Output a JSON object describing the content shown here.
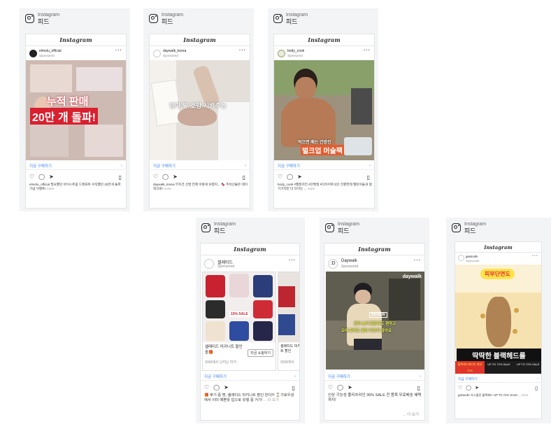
{
  "header": {
    "app_label": "Instagram",
    "feed_label": "피드"
  },
  "wordmark": "Instagram",
  "cta_label": "지금 구매하기",
  "more_label": "more",
  "more_label_kr": "... 더 보기",
  "ads": [
    {
      "account": "elmolu_official",
      "sponsored": "Sponsored",
      "overlay_line1": "누적 판매",
      "overlay_line2": "20만 개 돌파!",
      "caption": "elmolu_official 필요했던 아이스트림 드래프트 수직했던 20만개 돌파 기념 이벤트!",
      "bg": "#c9b7b0"
    },
    {
      "account": "daywalk_korea",
      "sponsored": "Sponsored",
      "overlay_line1": "엄마 발 호강 시켜주는",
      "caption": "daywalk_korea 무조건 신발 언제 이렇게 보였지... 🍫 추석선물은 데이워크로!",
      "bg": "#e2ddd6"
    },
    {
      "account": "body_cook",
      "sponsored": "Sponsored",
      "overlay_line1": "먹으면 배는 건방진",
      "overlay_line2": "벌크업 머슬팩",
      "caption": "body_cook #헬창치킨 #단백질 #다이어트식단 간편한데 헬린이들과 챙기기지만 더 다이는 ...",
      "bg": "#7f8a63"
    },
    {
      "account": "셀레티드",
      "sponsored": "Sponsored",
      "product_title": "셀레티드 미키니트 할인중🎁",
      "product_sub": "SNS에서 난리난 미키",
      "shop_button": "지금 쇼핑하기",
      "second_title": "셀레티드 미키니트 할인",
      "second_sub": "SNS에서",
      "sale_text": "15% SALE",
      "caption": "🎁 후기 증 명, 셀레티드 미키니트 할인 한다!!! ⌛️기로우셨에서 이미 예쁜옷 입으로 유행 중 거기!"
    },
    {
      "account": "Daywalk",
      "sponsored": "Sponsored",
      "brand_tag": "daywalk",
      "review_tag": "REVIEW",
      "overlay_line1": "굽이 높지 않은데도 편하고",
      "overlay_line2": "오래 걸어도 발이 아프지 않아요",
      "caption": "신상 기능성 플리츠라인 36% SALE 전 품목 무료배송 혜택까지!"
    },
    {
      "account": "gasmulin",
      "sponsored": "Sponsored",
      "pill": "피부단면도",
      "headline": "딱딱한 블랙헤드를",
      "promo_left": "블랙헤드패키지 최대72%",
      "promo_mid": "UP TO 72% SALE",
      "promo_right": "UP TO 72% SALE",
      "caption": "gasmulin 가스물린 블랙헤드 UP TO 72% SALE ..."
    }
  ]
}
